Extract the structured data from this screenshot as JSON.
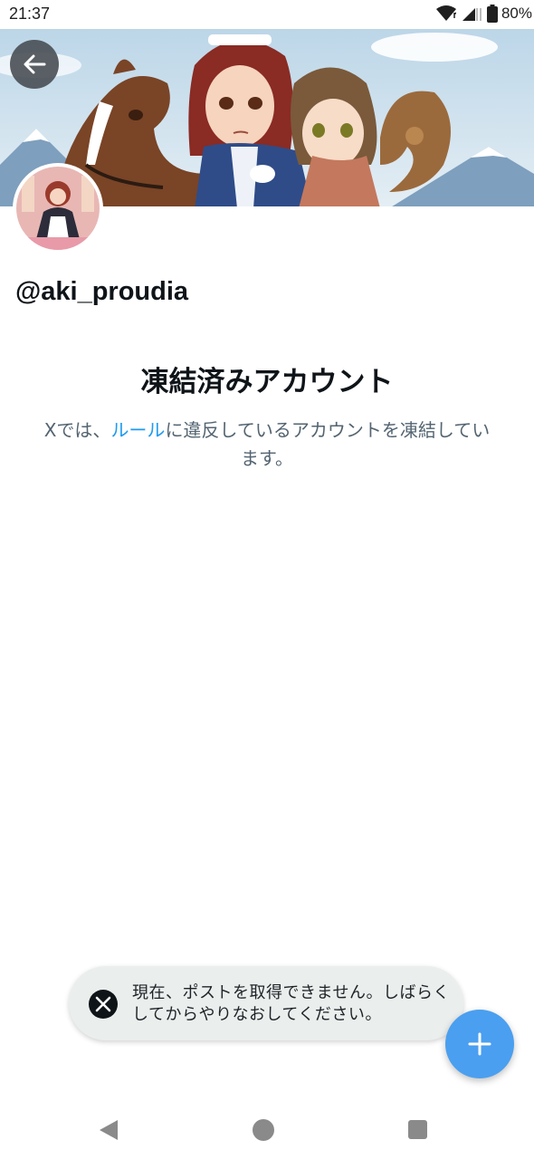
{
  "status_bar": {
    "time": "21:37",
    "battery": "80%",
    "icons": [
      "wifi-icon",
      "signal-icon",
      "battery-icon"
    ]
  },
  "header": {
    "back_icon": "arrow-left-icon"
  },
  "profile": {
    "handle": "@aki_proudia"
  },
  "suspended": {
    "title": "凍結済みアカウント",
    "text_before": "Xでは、",
    "link_text": "ルール",
    "text_after": "に違反しているアカウントを凍結しています。"
  },
  "toast": {
    "icon": "x-logo-icon",
    "message": "現在、ポストを取得できません。しばらくしてからやりなおしてください。"
  },
  "fab": {
    "icon": "plus-icon"
  },
  "nav_bar": {
    "icons": [
      "nav-back-icon",
      "nav-home-icon",
      "nav-recents-icon"
    ]
  },
  "colors": {
    "link": "#1d9bf0",
    "fab": "#4a9ff0",
    "secondary_text": "#536471",
    "toast_bg": "#eaeeec"
  }
}
